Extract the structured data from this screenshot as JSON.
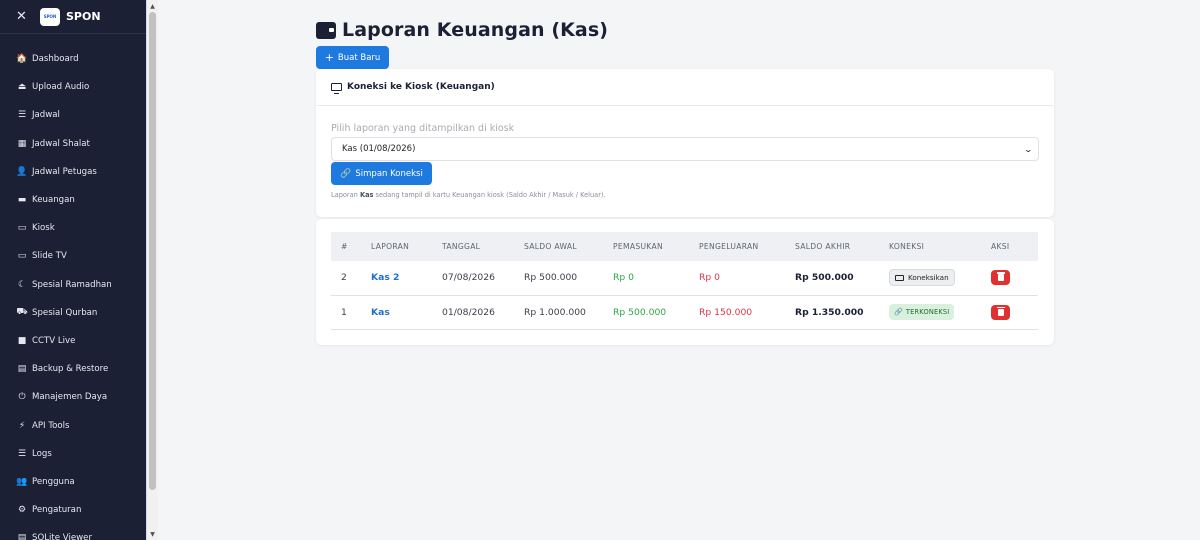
{
  "sidebar": {
    "brand": "SPON",
    "logo_text": "SPON",
    "close_glyph": "✕",
    "items": [
      {
        "label": "Dashboard",
        "icon": "home-icon",
        "glyph": "🏠"
      },
      {
        "label": "Upload Audio",
        "icon": "upload-icon",
        "glyph": "⏏"
      },
      {
        "label": "Jadwal",
        "icon": "list-icon",
        "glyph": "☰"
      },
      {
        "label": "Jadwal Shalat",
        "icon": "calendar-icon",
        "glyph": "▦"
      },
      {
        "label": "Jadwal Petugas",
        "icon": "user-icon",
        "glyph": "👤"
      },
      {
        "label": "Keuangan",
        "icon": "wallet-icon",
        "glyph": "▬"
      },
      {
        "label": "Kiosk",
        "icon": "monitor-icon",
        "glyph": "▭"
      },
      {
        "label": "Slide TV",
        "icon": "tv-icon",
        "glyph": "▭"
      },
      {
        "label": "Spesial Ramadhan",
        "icon": "moon-icon",
        "glyph": "☾"
      },
      {
        "label": "Spesial Qurban",
        "icon": "cow-icon",
        "glyph": "⛟"
      },
      {
        "label": "CCTV Live",
        "icon": "video-icon",
        "glyph": "■"
      },
      {
        "label": "Backup & Restore",
        "icon": "archive-icon",
        "glyph": "▤"
      },
      {
        "label": "Manajemen Daya",
        "icon": "power-icon",
        "glyph": "⏻"
      },
      {
        "label": "API Tools",
        "icon": "bolt-icon",
        "glyph": "⚡"
      },
      {
        "label": "Logs",
        "icon": "list-icon",
        "glyph": "☰"
      },
      {
        "label": "Pengguna",
        "icon": "users-icon",
        "glyph": "👥"
      },
      {
        "label": "Pengaturan",
        "icon": "gear-icon",
        "glyph": "⚙"
      },
      {
        "label": "SQLite Viewer",
        "icon": "database-icon",
        "glyph": "▤"
      }
    ]
  },
  "header": {
    "title": "Laporan Keuangan (Kas)",
    "new_button": "Buat Baru"
  },
  "kiosk": {
    "heading": "Koneksi ke Kiosk (Keuangan)",
    "select_label": "Pilih laporan yang ditampilkan di kiosk",
    "selected": "Kas (01/08/2026)",
    "save_button": "Simpan Koneksi",
    "hint_prefix": "Laporan ",
    "hint_report": "Kas",
    "hint_suffix": " sedang tampil di kartu Keuangan kiosk (Saldo Akhir / Masuk / Keluar)."
  },
  "table": {
    "headers": [
      "#",
      "LAPORAN",
      "TANGGAL",
      "SALDO AWAL",
      "PEMASUKAN",
      "PENGELUARAN",
      "SALDO AKHIR",
      "KONEKSI",
      "AKSI"
    ],
    "rows": [
      {
        "num": "2",
        "report": "Kas 2",
        "date": "07/08/2026",
        "start": "Rp 500.000",
        "income": "Rp 0",
        "expense": "Rp 0",
        "end": "Rp 500.000",
        "connection": "Koneksikan"
      },
      {
        "num": "1",
        "report": "Kas",
        "date": "01/08/2026",
        "start": "Rp 1.000.000",
        "income": "Rp 500.000",
        "expense": "Rp 150.000",
        "end": "Rp 1.350.000",
        "connection": "TERKONEKSI"
      }
    ]
  },
  "colors": {
    "sidebar_bg": "#1b2035",
    "primary": "#1f7ae0",
    "income": "#28a745",
    "expense": "#dc3545",
    "danger": "#e03131",
    "connected_bg": "#d8f0dc"
  }
}
